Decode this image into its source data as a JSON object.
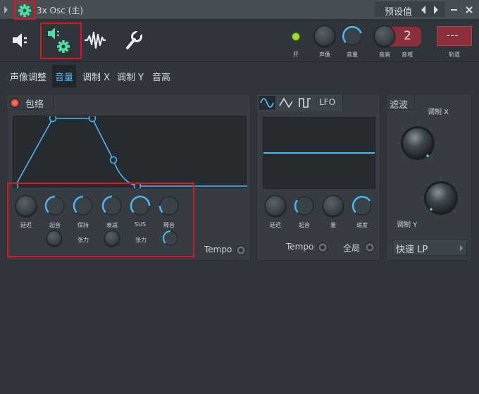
{
  "window": {
    "title": "3x Osc (主)",
    "preset_label": "预设值"
  },
  "toolbar": {
    "on_label": "开",
    "pan_label": "声像",
    "volume_label": "音量",
    "pitch_label": "音高",
    "range_label": "音域",
    "range_value": "2",
    "track_label": "轨道",
    "track_value": "---"
  },
  "tabs": [
    "声像调整",
    "音量",
    "调制 X",
    "调制 Y",
    "音高"
  ],
  "envelope": {
    "title": "包络",
    "knobs": [
      "延迟",
      "起音",
      "保持",
      "衰减",
      "SUS",
      "释音"
    ],
    "tension_labels": [
      "张力",
      "张力"
    ],
    "tempo_label": "Tempo"
  },
  "lfo": {
    "title": "LFO",
    "knobs": [
      "延迟",
      "起音",
      "量",
      "速度"
    ],
    "tempo_label": "Tempo",
    "global_label": "全局"
  },
  "filter": {
    "title": "滤波",
    "mod_x_label": "调制 X",
    "mod_y_label": "调制 Y",
    "type_value": "快速 LP"
  },
  "colors": {
    "accent": "#4fb6f2",
    "highlight": "#e3141b",
    "led": "#9be32a",
    "active_icon": "#4fe0a0"
  }
}
